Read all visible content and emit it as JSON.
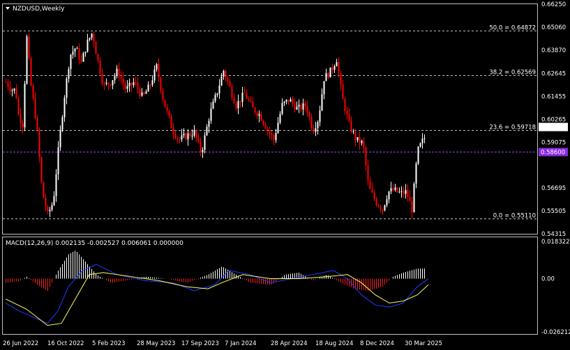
{
  "symbol": "NZDUSD,Weekly",
  "price_axis": {
    "labels": [
      "0.66250",
      "0.65060",
      "0.63870",
      "0.62645",
      "0.61455",
      "0.60265",
      "0.59075",
      "0.56695",
      "0.55505",
      "0.54315"
    ],
    "current_price": "0.59866",
    "marker_price": "0.58600"
  },
  "fibonacci": [
    {
      "label": "50.0 = 0.64872",
      "price": 0.64872
    },
    {
      "label": "38.2 = 0.62569",
      "price": 0.62569
    },
    {
      "label": "23.6 = 0.59718",
      "price": 0.59718
    },
    {
      "label": "0.0 = 0.55110",
      "price": 0.5511
    }
  ],
  "macd": {
    "label": "MACD(12,26,9) 0.002135 -0.002527 0.006061 0.000000",
    "axis_labels": [
      "0.018322",
      "0.00",
      "-0.026212"
    ]
  },
  "time_axis": [
    "26 Jun 2022",
    "16 Oct 2022",
    "5 Feb 2023",
    "28 May 2023",
    "17 Sep 2023",
    "7 Jan 2024",
    "28 Apr 2024",
    "18 Aug 2024",
    "8 Dec 2024",
    "30 Mar 2025"
  ],
  "colors": {
    "background": "#000000",
    "bull": "#ffffff",
    "bear": "#ff0000",
    "grid": "#c0c0c0",
    "marker_line": "#8a4bd8",
    "marker_box": "#8a2be2",
    "macd_histogram_pos": "#ffffff",
    "macd_histogram_neg": "#ff2020",
    "macd_line": "#1f3cff",
    "signal_line": "#ffff66"
  },
  "icons": [
    "dropdown-triangle-icon"
  ]
}
